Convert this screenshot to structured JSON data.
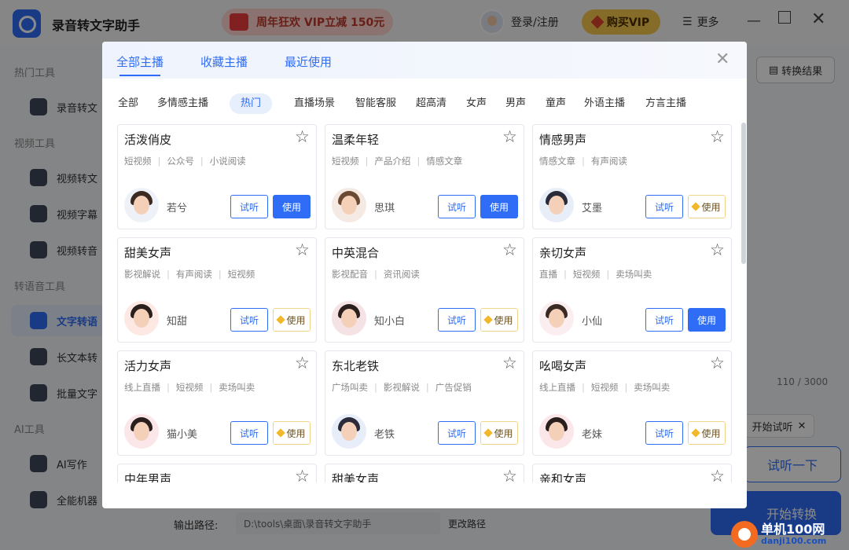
{
  "app": {
    "title": "录音转文字助手",
    "promo_text": "周年狂欢 VIP立减 150元",
    "login": "登录/注册",
    "buy_vip": "购买VIP",
    "more": "更多"
  },
  "sidebar": {
    "groups": [
      "热门工具",
      "视频工具",
      "转语音工具",
      "AI工具"
    ],
    "items": [
      {
        "label": "录音转文"
      },
      {
        "label": "视频转文"
      },
      {
        "label": "视频字幕"
      },
      {
        "label": "视频转音"
      },
      {
        "label": "文字转语"
      },
      {
        "label": "长文本转"
      },
      {
        "label": "批量文字"
      },
      {
        "label": "AI写作"
      },
      {
        "label": "全能机器"
      }
    ]
  },
  "main": {
    "result_button": "转换结果",
    "char_counter": "110 / 3000",
    "trial_tag": "开始试听",
    "listen_button": "试听一下",
    "start_button": "开始转换",
    "output_label": "输出路径:",
    "output_path": "D:\\tools\\桌面\\录音转文字助手",
    "change_path": "更改路径"
  },
  "watermark": {
    "title": "单机100网",
    "url": "danji100.com"
  },
  "modal": {
    "tabs": [
      "全部主播",
      "收藏主播",
      "最近使用"
    ],
    "categories": [
      "全部",
      "多情感主播",
      "热门",
      "直播场景",
      "智能客服",
      "超高清",
      "女声",
      "男声",
      "童声",
      "外语主播",
      "方言主播"
    ],
    "active_category": "热门",
    "listen_label": "试听",
    "use_label": "使用",
    "cards": [
      {
        "title": "活泼俏皮",
        "tags": [
          "短视频",
          "公众号",
          "小说阅读"
        ],
        "name": "若兮",
        "vip": false
      },
      {
        "title": "温柔年轻",
        "tags": [
          "短视频",
          "产品介绍",
          "情感文章"
        ],
        "name": "思琪",
        "vip": false
      },
      {
        "title": "情感男声",
        "tags": [
          "情感文章",
          "有声阅读"
        ],
        "name": "艾墨",
        "vip": true
      },
      {
        "title": "甜美女声",
        "tags": [
          "影视解说",
          "有声阅读",
          "短视频"
        ],
        "name": "知甜",
        "vip": true
      },
      {
        "title": "中英混合",
        "tags": [
          "影视配音",
          "资讯阅读"
        ],
        "name": "知小白",
        "vip": true
      },
      {
        "title": "亲切女声",
        "tags": [
          "直播",
          "短视频",
          "卖场叫卖"
        ],
        "name": "小仙",
        "vip": false
      },
      {
        "title": "活力女声",
        "tags": [
          "线上直播",
          "短视频",
          "卖场叫卖"
        ],
        "name": "猫小美",
        "vip": true
      },
      {
        "title": "东北老铁",
        "tags": [
          "广场叫卖",
          "影视解说",
          "广告促销"
        ],
        "name": "老铁",
        "vip": true
      },
      {
        "title": "吆喝女声",
        "tags": [
          "线上直播",
          "短视频",
          "卖场叫卖"
        ],
        "name": "老妹",
        "vip": true
      },
      {
        "title": "中年男声",
        "tags": [],
        "name": "",
        "vip": false
      },
      {
        "title": "甜美女声",
        "tags": [],
        "name": "",
        "vip": false
      },
      {
        "title": "亲和女声",
        "tags": [],
        "name": "",
        "vip": false
      }
    ]
  },
  "colors": {
    "accent": "#2f6df6",
    "vip_gold": "#f2b72b"
  }
}
